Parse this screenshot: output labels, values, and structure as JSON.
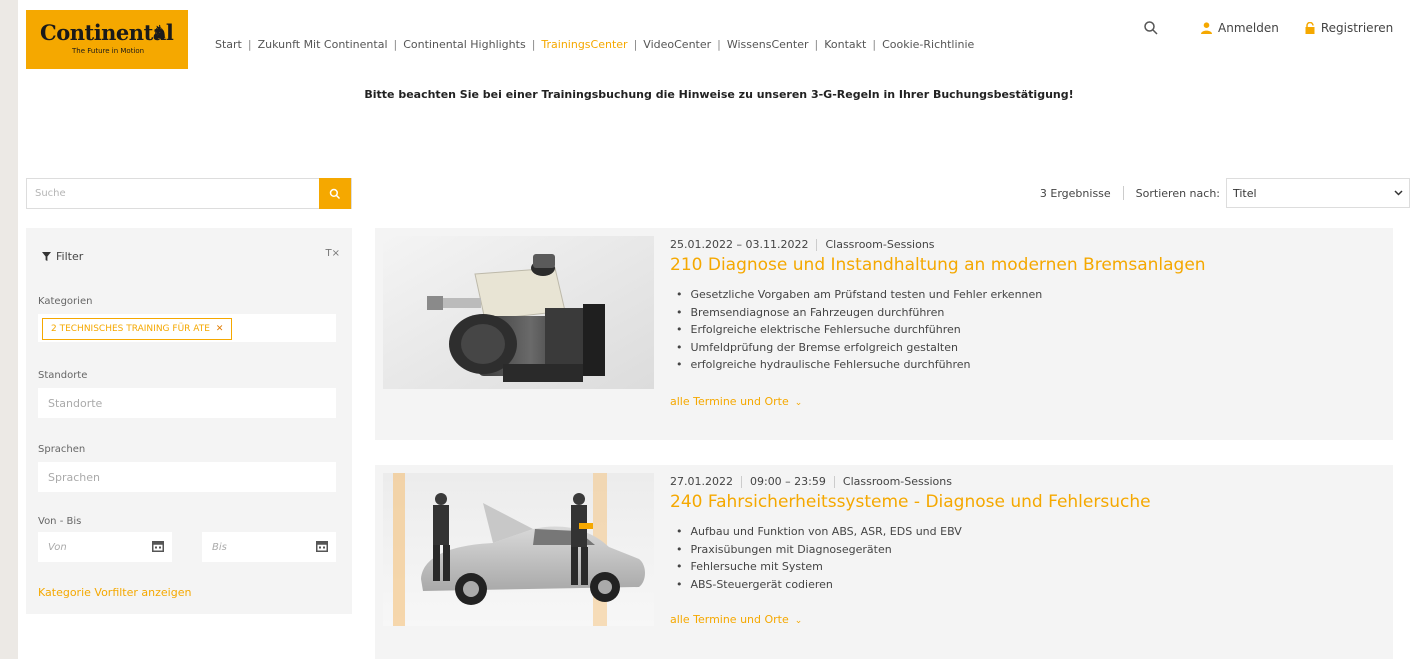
{
  "logo": {
    "name": "Continental",
    "tagline": "The Future in Motion",
    "color": "#f5a800"
  },
  "nav": {
    "items": [
      {
        "label": "Start",
        "active": false
      },
      {
        "label": "Zukunft Mit Continental",
        "active": false
      },
      {
        "label": "Continental Highlights",
        "active": false
      },
      {
        "label": "TrainingsCenter",
        "active": true
      },
      {
        "label": "VideoCenter",
        "active": false
      },
      {
        "label": "WissensCenter",
        "active": false
      },
      {
        "label": "Kontakt",
        "active": false
      },
      {
        "label": "Cookie-Richtlinie",
        "active": false
      }
    ]
  },
  "header": {
    "search_icon": "search-icon",
    "login_label": "Anmelden",
    "register_label": "Registrieren"
  },
  "notice": "Bitte beachten Sie bei einer Trainingsbuchung die Hinweise zu unseren 3-G-Regeln in Ihrer Buchungsbestätigung!",
  "search": {
    "placeholder": "Suche"
  },
  "filter": {
    "title": "Filter",
    "categories_label": "Kategorien",
    "category_chip": "2 TECHNISCHES TRAINING FÜR ATE",
    "locations_label": "Standorte",
    "locations_placeholder": "Standorte",
    "languages_label": "Sprachen",
    "languages_placeholder": "Sprachen",
    "daterange_label": "Von - Bis",
    "from_placeholder": "Von",
    "to_placeholder": "Bis",
    "prefilter_link": "Kategorie Vorfilter anzeigen"
  },
  "results": {
    "count_label": "3 Ergebnisse",
    "sort_label": "Sortieren nach:",
    "sort_value": "Titel"
  },
  "cards": [
    {
      "dates": "25.01.2022 – 03.11.2022",
      "time": "",
      "type": "Classroom-Sessions",
      "title": "210 Diagnose und Instandhaltung an modernen Bremsanlagen",
      "bullets": [
        "Gesetzliche Vorgaben am Prüfstand testen und Fehler erkennen",
        "Bremsendiagnose an Fahrzeugen durchführen",
        "Erfolgreiche elektrische Fehlersuche durchführen",
        "Umfeldprüfung der Bremse erfolgreich gestalten",
        "erfolgreiche hydraulische Fehlersuche durchführen"
      ],
      "more_link": "alle Termine und Orte"
    },
    {
      "dates": "27.01.2022",
      "time": "09:00 – 23:59",
      "type": "Classroom-Sessions",
      "title": "240 Fahrsicherheitssysteme - Diagnose und Fehlersuche",
      "bullets": [
        "Aufbau und Funktion von ABS, ASR, EDS und EBV",
        "Praxisübungen mit Diagnosegeräten",
        "Fehlersuche mit System",
        "ABS-Steuergerät codieren"
      ],
      "more_link": "alle Termine und Orte"
    }
  ]
}
